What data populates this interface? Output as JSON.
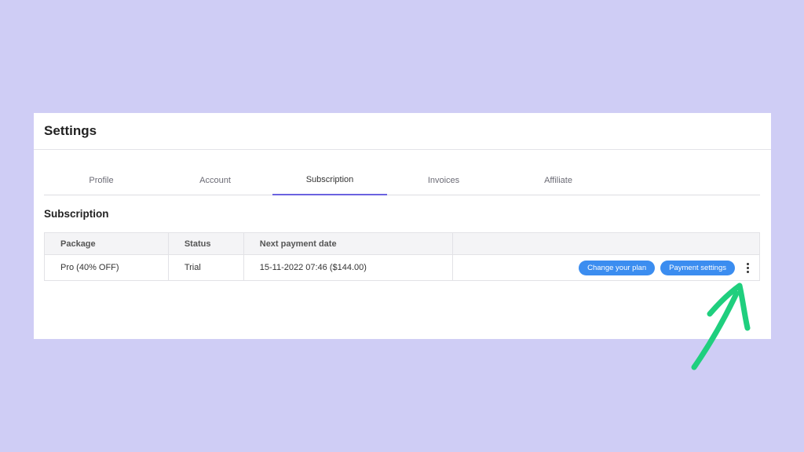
{
  "settings": {
    "title": "Settings"
  },
  "tabs": [
    {
      "label": "Profile",
      "active": false
    },
    {
      "label": "Account",
      "active": false
    },
    {
      "label": "Subscription",
      "active": true
    },
    {
      "label": "Invoices",
      "active": false
    },
    {
      "label": "Affiliate",
      "active": false
    }
  ],
  "subscription": {
    "title": "Subscription",
    "columns": [
      "Package",
      "Status",
      "Next payment date",
      ""
    ],
    "rows": [
      {
        "package": "Pro (40% OFF)",
        "status": "Trial",
        "next_payment": "15-11-2022 07:46 ($144.00)",
        "change_plan_label": "Change your plan",
        "payment_settings_label": "Payment settings"
      }
    ]
  },
  "icons": {
    "more": "kebab-menu-icon",
    "annotation": "arrow-icon"
  },
  "colors": {
    "background": "#cfcdf5",
    "accent": "#6b63e0",
    "button": "#3b8df0",
    "annotation": "#1fcf7e"
  }
}
